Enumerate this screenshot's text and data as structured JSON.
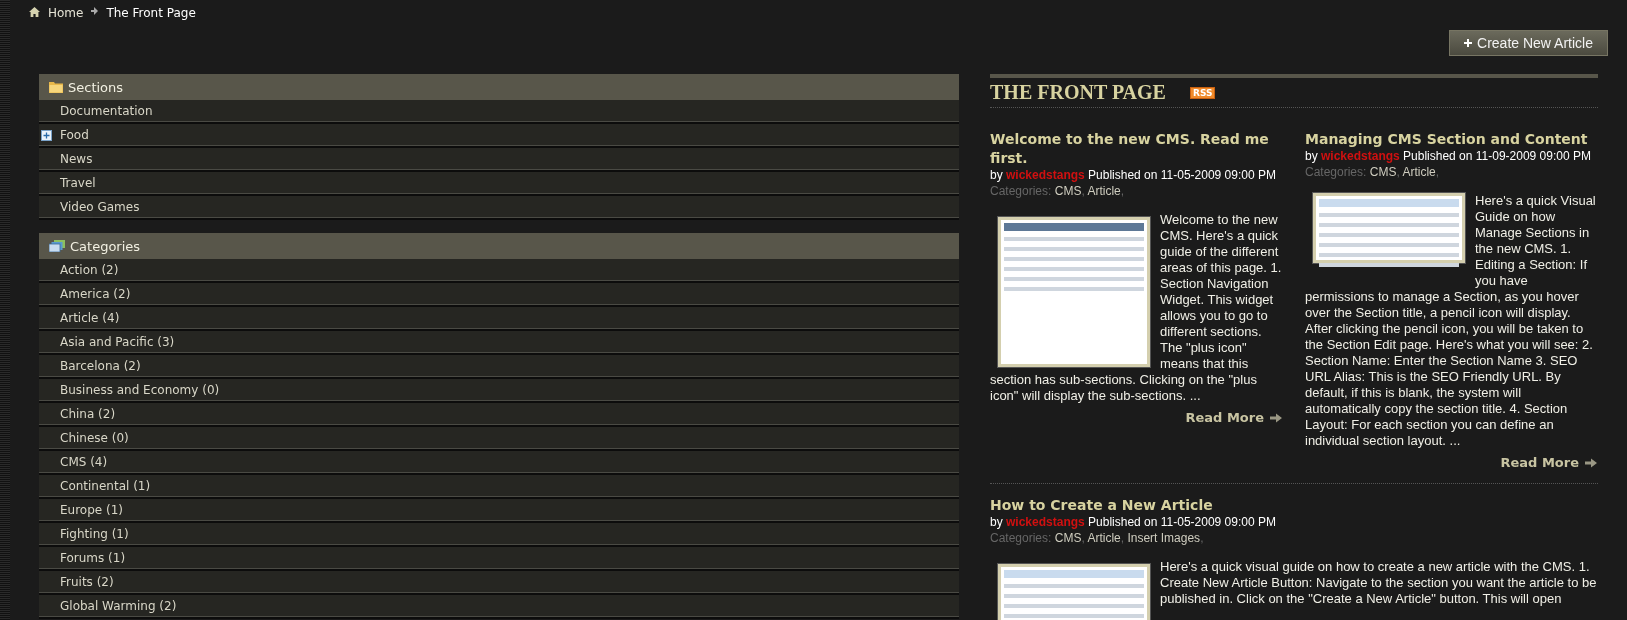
{
  "breadcrumb": [
    {
      "label": "Home"
    },
    {
      "label": "The Front Page"
    }
  ],
  "create_button": {
    "label": "Create New Article"
  },
  "sections": {
    "title": "Sections",
    "items": [
      {
        "label": "Documentation",
        "has_children": false
      },
      {
        "label": "Food",
        "has_children": true
      },
      {
        "label": "News",
        "has_children": false
      },
      {
        "label": "Travel",
        "has_children": false
      },
      {
        "label": "Video Games",
        "has_children": false
      }
    ]
  },
  "categories": {
    "title": "Categories",
    "items": [
      {
        "label": "Action (2)"
      },
      {
        "label": "America (2)"
      },
      {
        "label": "Article (4)"
      },
      {
        "label": "Asia and Pacific (3)"
      },
      {
        "label": "Barcelona (2)"
      },
      {
        "label": "Business and Economy (0)"
      },
      {
        "label": "China (2)"
      },
      {
        "label": "Chinese (0)"
      },
      {
        "label": "CMS (4)"
      },
      {
        "label": "Continental (1)"
      },
      {
        "label": "Europe (1)"
      },
      {
        "label": "Fighting (1)"
      },
      {
        "label": "Forums (1)"
      },
      {
        "label": "Fruits (2)"
      },
      {
        "label": "Global Warming (2)"
      }
    ]
  },
  "page_title": "THE FRONT PAGE",
  "rss_label": "RSS",
  "articles": [
    {
      "kind": "column",
      "thumbnail": {
        "kind": "tall"
      },
      "title": "Welcome to the new CMS. Read me first.",
      "byline_prefix": "by",
      "author": "wickedstangs",
      "published": "Published on 11-05-2009 09:00 PM",
      "categories_label": "Categories:",
      "categories": [
        "CMS",
        "Article"
      ],
      "separator": ",",
      "body_beside": "Welcome to the new CMS. Here's a quick guide of the different areas of this page. 1. Section Navigation Widget. This widget allows you to go to different sections. The \"plus icon\" means that this",
      "body_below": "section has sub-sections. Clicking on the \"plus icon\" will display the sub-sections. ...",
      "read_more": "Read More"
    },
    {
      "kind": "column",
      "thumbnail": {
        "kind": "short"
      },
      "title": "Managing CMS Section and Content",
      "byline_prefix": "by",
      "author": "wickedstangs",
      "published": "Published on 11-09-2009 09:00 PM",
      "categories_label": "Categories:",
      "categories": [
        "CMS",
        "Article"
      ],
      "separator": ",",
      "body_beside": "Here's a quick Visual Guide on how Manage Sections in the new CMS. 1. Editing a Section: If you have",
      "body_below": "permissions to manage a Section, as you hover over the Section title, a pencil icon will display. After clicking the pencil icon, you will be taken to the Section Edit page. Here's what you will see: 2. Section Name: Enter the Section Name 3. SEO URL Alias: This is the SEO Friendly URL. By default, if this is blank, the system will automatically copy the section title. 4. Section Layout: For each section you can define an individual section layout. ...",
      "read_more": "Read More"
    },
    {
      "kind": "wide",
      "thumbnail": {
        "kind": "form"
      },
      "title": "How to Create a New Article",
      "byline_prefix": "by",
      "author": "wickedstangs",
      "published": "Published on 11-05-2009 09:00 PM",
      "categories_label": "Categories:",
      "categories": [
        "CMS",
        "Article",
        "Insert Images"
      ],
      "separator": ",",
      "body_beside": "Here's a quick visual guide on how to create a new article with the CMS. 1. Create New Article Button: Navigate to the section you want the article to be published in. Click on the \"Create a New Article\" button. This will open"
    }
  ]
}
